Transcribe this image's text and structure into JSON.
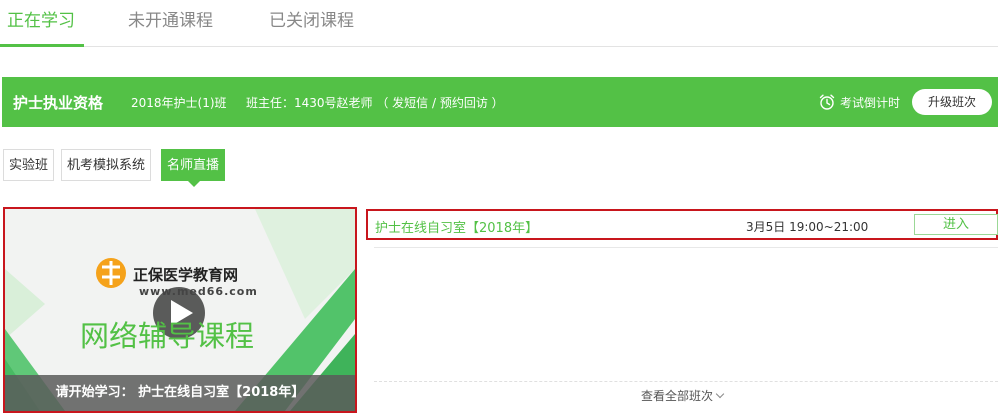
{
  "top_tabs": [
    {
      "label": "正在学习",
      "active": true
    },
    {
      "label": "未开通课程",
      "active": false
    },
    {
      "label": "已关闭课程",
      "active": false
    }
  ],
  "class_bar": {
    "title": "护士执业资格",
    "class_name": "2018年护士(1)班",
    "teacher": "班主任：1430号赵老师 （ 发短信 / 预约回访 ）",
    "countdown_label": "考试倒计时",
    "upgrade_label": "升级班次",
    "icon": "alarm-clock-icon",
    "color": "#53c146"
  },
  "sub_tabs": [
    {
      "label": "实验班",
      "active": false
    },
    {
      "label": "机考模拟系统",
      "active": false
    },
    {
      "label": "名师直播",
      "active": true
    }
  ],
  "video": {
    "brand_name": "正保医学教育网",
    "brand_url": "www.med66.com",
    "course_banner": "网络辅导课程",
    "caption": "请开始学习： 护士在线自习室【2018年】",
    "play_icon": "play-icon"
  },
  "courses": [
    {
      "title": "护士在线自习室【2018年】",
      "time": "3月5日 19:00~21:00",
      "action": "进入"
    }
  ],
  "view_all_label": "查看全部班次",
  "colors": {
    "accent": "#53c146",
    "highlight_border": "#c8161d"
  }
}
